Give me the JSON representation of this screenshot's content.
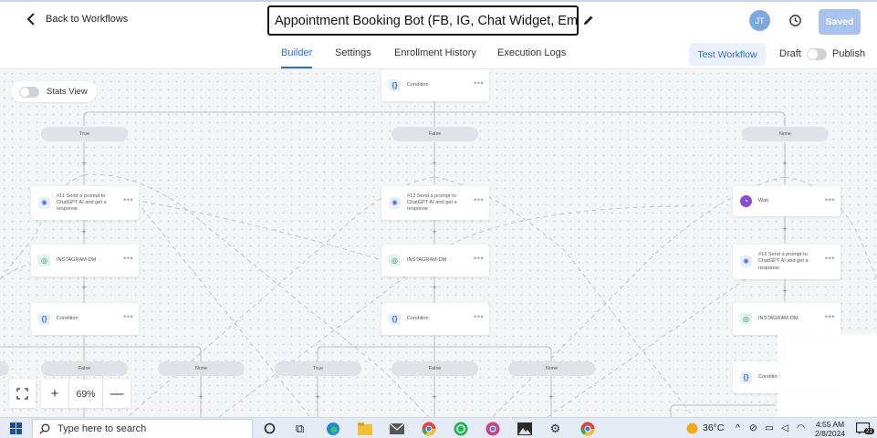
{
  "header": {
    "back_label": "Back to Workflows",
    "workflow_title": "Appointment Booking Bot (FB, IG, Chat Widget, Email)",
    "avatar_initials": "JT",
    "saved_label": "Saved"
  },
  "tabs": {
    "items": [
      "Builder",
      "Settings",
      "Enrollment History",
      "Execution Logs"
    ],
    "active": "Builder",
    "test_workflow_label": "Test Workflow",
    "draft_label": "Draft",
    "publish_label": "Publish"
  },
  "canvas": {
    "stats_view_label": "Stats View",
    "top_condition": {
      "label": "Condition",
      "icon": "braces-icon"
    },
    "branches": [
      "True",
      "False",
      "None"
    ],
    "column_true": {
      "nodes": [
        {
          "label": "#11 Send a prompt to ChatGPT AI and get a response",
          "icon": "chatgpt-icon"
        },
        {
          "label": "INSTAGRAM-DM",
          "icon": "instagram-icon"
        },
        {
          "label": "Condition",
          "icon": "braces-icon"
        }
      ]
    },
    "column_false": {
      "nodes": [
        {
          "label": "#12 Send a prompt to ChatGPT AI and get a response",
          "icon": "chatgpt-icon"
        },
        {
          "label": "INSTAGRAM-DM",
          "icon": "instagram-icon"
        },
        {
          "label": "Condition",
          "icon": "braces-icon"
        }
      ]
    },
    "column_none": {
      "nodes": [
        {
          "label": "Wait",
          "icon": "clock-icon"
        },
        {
          "label": "#13 Send a prompt to ChatGPT AI and get a response",
          "icon": "chatgpt-icon"
        },
        {
          "label": "INSTAGRAM-DM",
          "icon": "instagram-icon"
        },
        {
          "label": "Condition",
          "icon": "braces-icon"
        }
      ]
    },
    "sub_branches_left": [
      "False",
      "None"
    ],
    "sub_branches_mid": [
      "True",
      "False",
      "None"
    ],
    "zoom_level": "69%",
    "colors": {
      "accent": "#2d6ecb",
      "saved_button": "#a9c3f0",
      "wait_icon": "#8b4ad8",
      "instagram_icon": "#159a5a"
    }
  },
  "taskbar": {
    "search_placeholder": "Type here to search",
    "weather": "36°C",
    "time": "4:55 AM",
    "date": "2/8/2024",
    "notification_count": "21"
  }
}
